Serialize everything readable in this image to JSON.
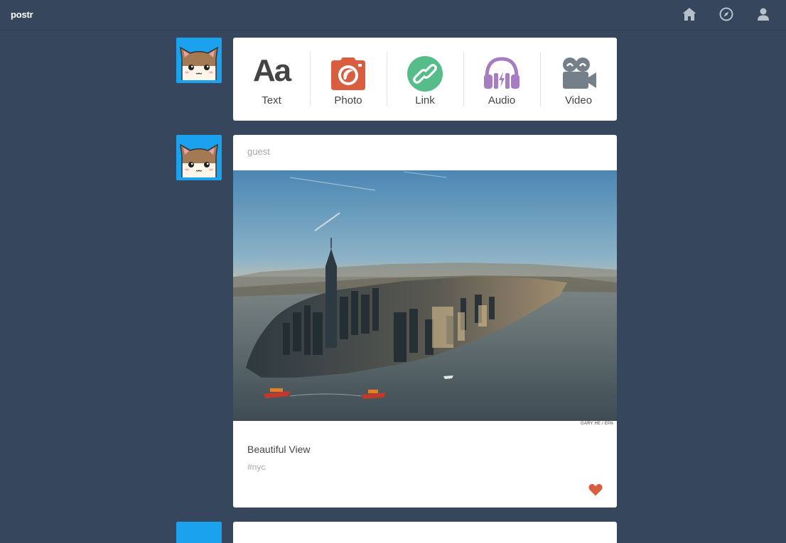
{
  "app": {
    "name": "postr"
  },
  "nav": {
    "icons": [
      "home-icon",
      "compass-icon",
      "user-icon"
    ]
  },
  "compose": {
    "types": [
      {
        "label": "Text",
        "icon": "text-icon",
        "glyph": "Aa",
        "color": "#444444"
      },
      {
        "label": "Photo",
        "icon": "camera-icon",
        "color": "#d95e40"
      },
      {
        "label": "Link",
        "icon": "link-icon",
        "color": "#56bc8a"
      },
      {
        "label": "Audio",
        "icon": "headphones-icon",
        "color": "#a77dc2"
      },
      {
        "label": "Video",
        "icon": "video-camera-icon",
        "color": "#748089"
      }
    ]
  },
  "post": {
    "author": "guest",
    "image_credit": "GARY HE / EPA",
    "title": "Beautiful View",
    "tag": "#nyc",
    "like_icon": "heart-icon",
    "like_color": "#d95e40"
  },
  "colors": {
    "background": "#36465d",
    "card": "#ffffff",
    "avatar_bg": "#1aa2ee"
  }
}
